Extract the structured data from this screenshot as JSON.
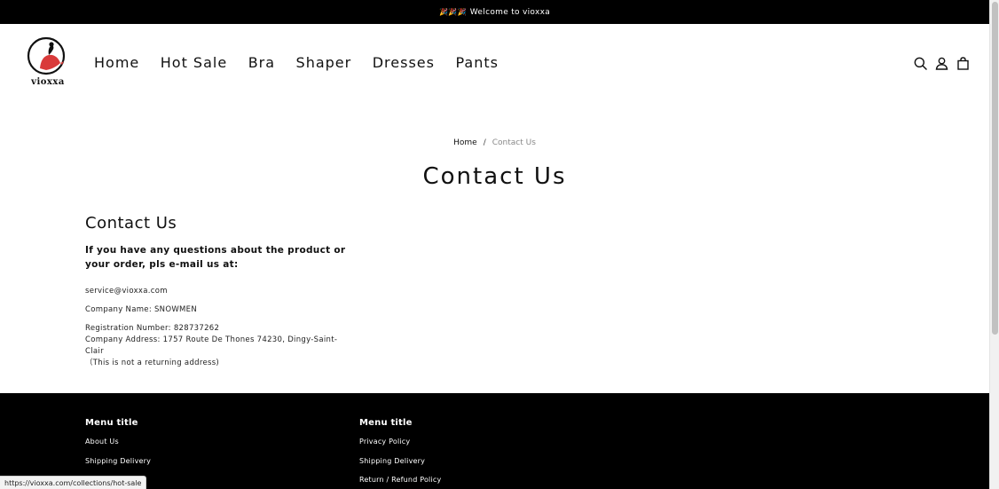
{
  "announcement": {
    "prefix": "🎉🎉🎉",
    "text": "Welcome to vioxxa"
  },
  "header": {
    "logo_text": "vioxxa",
    "nav": [
      "Home",
      "Hot Sale",
      "Bra",
      "Shaper",
      "Dresses",
      "Pants"
    ]
  },
  "breadcrumb": {
    "home": "Home",
    "separator": "/",
    "current": "Contact Us"
  },
  "page_title": "Contact Us",
  "content": {
    "heading": "Contact Us",
    "lead": "If you have any questions about the product or your order, pls e-mail us at:",
    "email": "service@vioxxa.com",
    "company_name": "Company Name: SNOWMEN",
    "registration": "Registration Number: 828737262",
    "address": "Company Address: 1757 Route De Thones 74230, Dingy-Saint-Clair",
    "note": "（This is not a returning address)"
  },
  "footer": {
    "columns": [
      {
        "title": "Menu title",
        "links": [
          "About Us",
          "Shipping Delivery"
        ]
      },
      {
        "title": "Menu title",
        "links": [
          "Privacy Policy",
          "Shipping Delivery",
          "Return / Refund Policy"
        ]
      }
    ]
  },
  "status_url": "https://vioxxa.com/collections/hot-sale",
  "colors": {
    "accent": "#d93a3a",
    "dark": "#000000"
  }
}
